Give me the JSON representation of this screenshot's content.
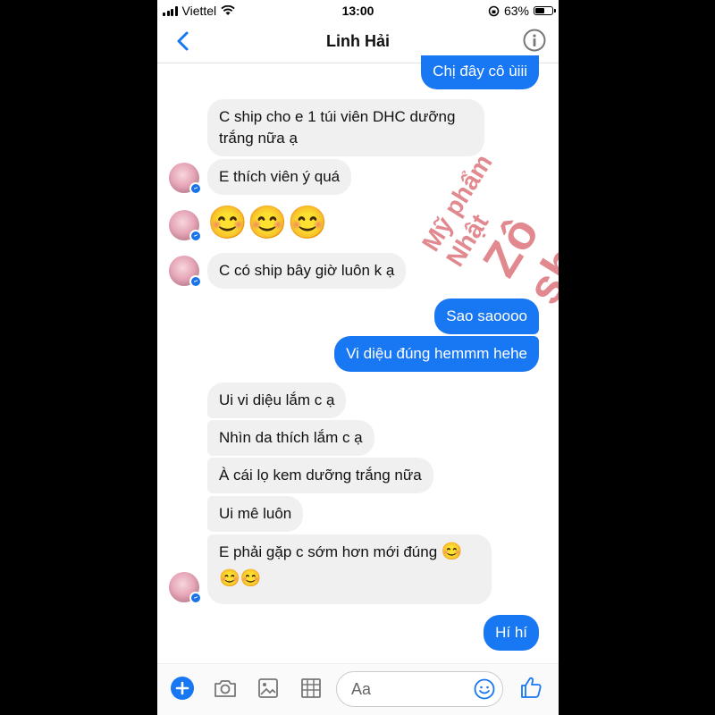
{
  "status_bar": {
    "carrier": "Viettel",
    "time": "13:00",
    "battery": "63%",
    "battery_level": 0.63
  },
  "header": {
    "title": "Linh Hải"
  },
  "messages": {
    "m1": "Chị đây cô ùiii",
    "m2_line1": "C ship cho e 1 túi viên DHC dưỡng",
    "m2_line2": "trắng nữa ạ",
    "m3": "E thích viên ý quá",
    "m4": "😊😊😊",
    "m5": "C có ship bây giờ luôn k ạ",
    "m6": "Sao saoooo",
    "m7": "Vi diệu đúng hemmm hehe",
    "m8": "Ui vi diệu lắm c ạ",
    "m9": "Nhìn da thích lắm c ạ",
    "m10": "À cái lọ kem dưỡng trắng nữa",
    "m11": "Ui mê luôn",
    "m12_line1": "E phải gặp c sớm hơn mới đúng",
    "m12_emoji1": "😊",
    "m12_line2": "😊😊",
    "m13": "Hí hí"
  },
  "watermark": {
    "line1": "Mỹ phẩm Nhật",
    "line2": "Zô shop"
  },
  "composer": {
    "placeholder": "Aa"
  },
  "colors": {
    "accent": "#1877f2",
    "incoming": "#f0f0f0"
  },
  "icons": [
    "back-chevron-icon",
    "info-icon",
    "plus-icon",
    "camera-icon",
    "gallery-icon",
    "sticker-grid-icon",
    "emoji-icon",
    "thumbs-up-icon",
    "messenger-badge-icon"
  ]
}
